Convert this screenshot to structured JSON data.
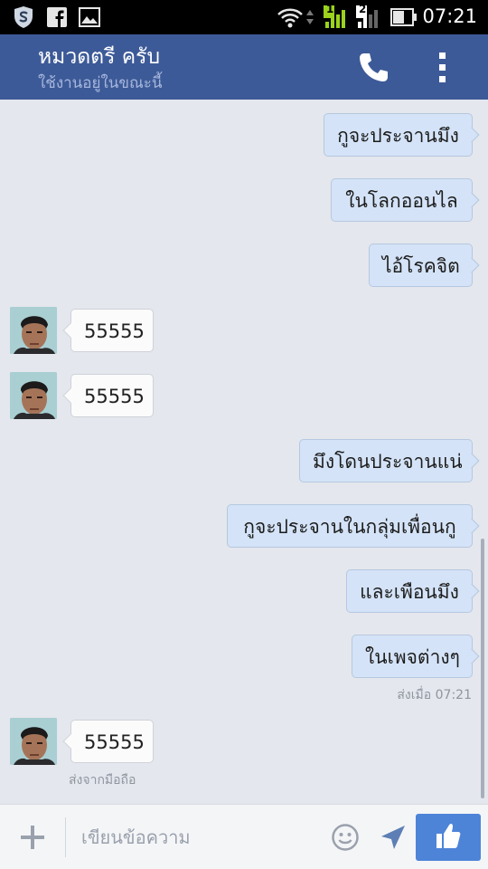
{
  "status_bar": {
    "time": "07:21",
    "sim1_label": "1",
    "sim2_label": "2"
  },
  "header": {
    "contact_name": "หมวดตรี ครับ",
    "contact_status": "ใช้งานอยู่ในขณะนี้"
  },
  "messages": [
    {
      "dir": "out",
      "text": "กูจะประจานมึง"
    },
    {
      "dir": "out",
      "text": "ในโลกออนไล"
    },
    {
      "dir": "out",
      "text": "ไอ้โรคจิต"
    },
    {
      "dir": "in",
      "text": "55555"
    },
    {
      "dir": "in",
      "text": "55555"
    },
    {
      "dir": "out",
      "text": "มึงโดนประจานแน่"
    },
    {
      "dir": "out",
      "text": "กูจะประจานในกลุ่มเพื่อนกู"
    },
    {
      "dir": "out",
      "text": "และเพือนมึง"
    },
    {
      "dir": "out",
      "text": "ในเพจต่างๆ"
    },
    {
      "dir": "in",
      "text": "55555"
    }
  ],
  "sent_meta": "ส่งเมื่อ 07:21",
  "received_meta": "ส่งจากมือถือ",
  "composer": {
    "placeholder": "เขียนข้อความ"
  },
  "colors": {
    "header_bg": "#3d5a98",
    "outgoing_bubble": "#d4e3f7",
    "incoming_bubble": "#fbfbfb",
    "like_button": "#4d84d8",
    "chat_bg": "#e4e7ed"
  },
  "icons": [
    "shield-icon",
    "facebook-icon",
    "gallery-icon",
    "wifi-icon",
    "signal-icon",
    "battery-icon",
    "phone-icon",
    "more-vert-icon",
    "plus-icon",
    "smiley-icon",
    "send-icon",
    "thumbs-up-icon"
  ]
}
